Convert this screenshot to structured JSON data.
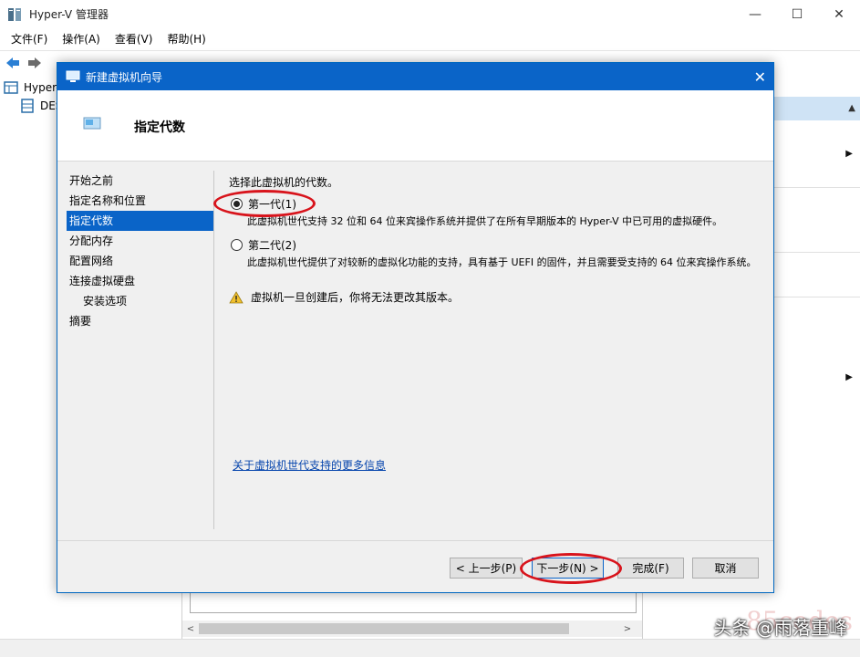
{
  "app": {
    "title": "Hyper-V 管理器",
    "minimize": "—",
    "maximize": "☐",
    "close": "✕"
  },
  "menu": [
    "文件(F)",
    "操作(A)",
    "查看(V)",
    "帮助(H)"
  ],
  "tree": {
    "root_label": "Hyper-",
    "child_label": "DES"
  },
  "dialog": {
    "title": "新建虚拟机向导",
    "close": "✕",
    "header_title": "指定代数",
    "steps": [
      "开始之前",
      "指定名称和位置",
      "指定代数",
      "分配内存",
      "配置网络",
      "连接虚拟硬盘",
      "安装选项",
      "摘要"
    ],
    "active_step": 2,
    "prompt": "选择此虚拟机的代数。",
    "gen1": {
      "label": "第一代(1)",
      "desc": "此虚拟机世代支持 32 位和 64 位来宾操作系统并提供了在所有早期版本的 Hyper-V 中已可用的虚拟硬件。",
      "selected": true
    },
    "gen2": {
      "label": "第二代(2)",
      "desc": "此虚拟机世代提供了对较新的虚拟化功能的支持，具有基于 UEFI 的固件，并且需要受支持的 64 位来宾操作系统。",
      "selected": false
    },
    "warning": "虚拟机一旦创建后，你将无法更改其版本。",
    "more_link": "关于虚拟机世代支持的更多信息",
    "buttons": {
      "prev": "< 上一步(P)",
      "next": "下一步(N) >",
      "finish": "完成(F)",
      "cancel": "取消"
    }
  },
  "watermark": {
    "text": "头条 @雨落重峰",
    "bg_text": "85codes"
  },
  "colors": {
    "accent": "#0a64c8",
    "highlight": "#d8141c",
    "right_header": "#cfe3f5"
  }
}
